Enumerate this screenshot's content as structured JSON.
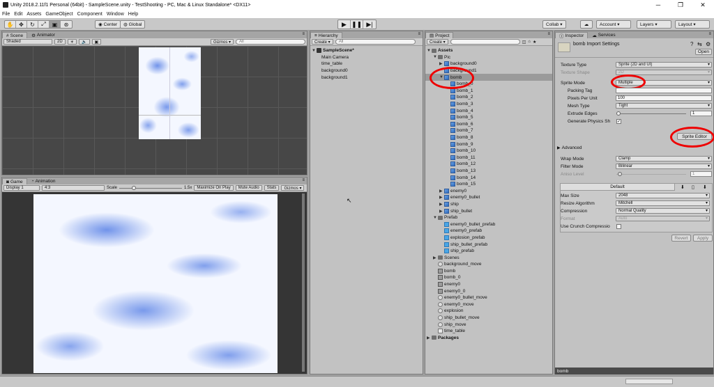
{
  "window": {
    "title": "Unity 2018.2.11f1 Personal (64bit) - SampleScene.unity - TestShooting - PC, Mac & Linux Standalone* <DX11>"
  },
  "menu": [
    "File",
    "Edit",
    "Assets",
    "GameObject",
    "Component",
    "Window",
    "Help"
  ],
  "toolbar": {
    "center": "Center",
    "global": "Global",
    "collab": "Collab ▾",
    "account": "Account ▾",
    "layers": "Layers ▾",
    "layout": "Layout ▾"
  },
  "scene": {
    "tab": "Scene",
    "tab2": "Animator",
    "shading": "Shaded",
    "mode2d": "2D",
    "gizmos": "Gizmos ▾",
    "search": "All"
  },
  "game": {
    "tab": "Game",
    "tab2": "Animation",
    "display": "Display 1",
    "aspect": "4:3",
    "scale_label": "Scale",
    "scale_value": "1.5x",
    "maximize": "Maximize On Play",
    "mute": "Mute Audio",
    "stats": "Stats",
    "gizmos": "Gizmos ▾"
  },
  "hierarchy": {
    "tab": "Hierarchy",
    "create": "Create ▾",
    "search": "All",
    "scene_name": "SampleScene*",
    "items": [
      "Main Camera",
      "time_table",
      "background0",
      "background1"
    ]
  },
  "project": {
    "tab": "Project",
    "create": "Create ▾",
    "items": [
      {
        "label": "Assets",
        "icon": "folder",
        "indent": 0,
        "arrow": "▼",
        "bold": true
      },
      {
        "label": "Pic",
        "icon": "folder",
        "indent": 1,
        "arrow": "▼"
      },
      {
        "label": "background0",
        "icon": "sprite",
        "indent": 2,
        "arrow": "▶"
      },
      {
        "label": "background1",
        "icon": "sprite",
        "indent": 2,
        "arrow": ""
      },
      {
        "label": "bomb",
        "icon": "sprite",
        "indent": 2,
        "arrow": "▼",
        "selected": true
      },
      {
        "label": "bomb_0",
        "icon": "sprite",
        "indent": 3,
        "arrow": ""
      },
      {
        "label": "bomb_1",
        "icon": "sprite",
        "indent": 3,
        "arrow": ""
      },
      {
        "label": "bomb_2",
        "icon": "sprite",
        "indent": 3,
        "arrow": ""
      },
      {
        "label": "bomb_3",
        "icon": "sprite",
        "indent": 3,
        "arrow": ""
      },
      {
        "label": "bomb_4",
        "icon": "sprite",
        "indent": 3,
        "arrow": ""
      },
      {
        "label": "bomb_5",
        "icon": "sprite",
        "indent": 3,
        "arrow": ""
      },
      {
        "label": "bomb_6",
        "icon": "sprite",
        "indent": 3,
        "arrow": ""
      },
      {
        "label": "bomb_7",
        "icon": "sprite",
        "indent": 3,
        "arrow": ""
      },
      {
        "label": "bomb_8",
        "icon": "sprite",
        "indent": 3,
        "arrow": ""
      },
      {
        "label": "bomb_9",
        "icon": "sprite",
        "indent": 3,
        "arrow": ""
      },
      {
        "label": "bomb_10",
        "icon": "sprite",
        "indent": 3,
        "arrow": ""
      },
      {
        "label": "bomb_11",
        "icon": "sprite",
        "indent": 3,
        "arrow": ""
      },
      {
        "label": "bomb_12",
        "icon": "sprite",
        "indent": 3,
        "arrow": ""
      },
      {
        "label": "bomb_13",
        "icon": "sprite",
        "indent": 3,
        "arrow": ""
      },
      {
        "label": "bomb_14",
        "icon": "sprite",
        "indent": 3,
        "arrow": ""
      },
      {
        "label": "bomb_15",
        "icon": "sprite",
        "indent": 3,
        "arrow": ""
      },
      {
        "label": "enemy0",
        "icon": "sprite",
        "indent": 2,
        "arrow": "▶"
      },
      {
        "label": "enemy0_bullet",
        "icon": "sprite",
        "indent": 2,
        "arrow": "▶"
      },
      {
        "label": "ship",
        "icon": "sprite",
        "indent": 2,
        "arrow": "▶"
      },
      {
        "label": "ship_bullet",
        "icon": "sprite",
        "indent": 2,
        "arrow": "▶"
      },
      {
        "label": "Prefab",
        "icon": "folder",
        "indent": 1,
        "arrow": "▼"
      },
      {
        "label": "enemy0_bullet_prefab",
        "icon": "prefab",
        "indent": 2,
        "arrow": ""
      },
      {
        "label": "enemy0_prefab",
        "icon": "prefab",
        "indent": 2,
        "arrow": ""
      },
      {
        "label": "explosion_prefab",
        "icon": "prefab",
        "indent": 2,
        "arrow": ""
      },
      {
        "label": "ship_bullet_prefab",
        "icon": "prefab",
        "indent": 2,
        "arrow": ""
      },
      {
        "label": "ship_prefab",
        "icon": "prefab",
        "indent": 2,
        "arrow": ""
      },
      {
        "label": "Scenes",
        "icon": "folder",
        "indent": 1,
        "arrow": "▶"
      },
      {
        "label": "background_move",
        "icon": "anim",
        "indent": 1,
        "arrow": ""
      },
      {
        "label": "bomb",
        "icon": "ctrl",
        "indent": 1,
        "arrow": ""
      },
      {
        "label": "bomb_0",
        "icon": "ctrl",
        "indent": 1,
        "arrow": ""
      },
      {
        "label": "enemy0",
        "icon": "ctrl",
        "indent": 1,
        "arrow": ""
      },
      {
        "label": "enemy0_0",
        "icon": "ctrl",
        "indent": 1,
        "arrow": ""
      },
      {
        "label": "enemy0_bullet_move",
        "icon": "anim",
        "indent": 1,
        "arrow": ""
      },
      {
        "label": "enemy0_move",
        "icon": "anim",
        "indent": 1,
        "arrow": ""
      },
      {
        "label": "explosion",
        "icon": "anim",
        "indent": 1,
        "arrow": ""
      },
      {
        "label": "ship_bullet_move",
        "icon": "anim",
        "indent": 1,
        "arrow": ""
      },
      {
        "label": "ship_move",
        "icon": "anim",
        "indent": 1,
        "arrow": ""
      },
      {
        "label": "time_table",
        "icon": "script",
        "indent": 1,
        "arrow": ""
      },
      {
        "label": "Packages",
        "icon": "folder",
        "indent": 0,
        "arrow": "▶",
        "bold": true
      }
    ]
  },
  "inspector": {
    "tab": "Inspector",
    "tab2": "Services",
    "title": "bomb Import Settings",
    "open": "Open",
    "texture_type_label": "Texture Type",
    "texture_type": "Sprite (2D and UI)",
    "texture_shape_label": "Texture Shape",
    "texture_shape": "2D",
    "sprite_mode_label": "Sprite Mode",
    "sprite_mode": "Multiple",
    "packing_tag_label": "Packing Tag",
    "ppu_label": "Pixels Per Unit",
    "ppu": "100",
    "mesh_type_label": "Mesh Type",
    "mesh_type": "Tight",
    "extrude_label": "Extrude Edges",
    "extrude": "1",
    "physics_label": "Generate Physics Sh",
    "sprite_editor": "Sprite Editor",
    "advanced": "Advanced",
    "wrap_label": "Wrap Mode",
    "wrap": "Clamp",
    "filter_label": "Filter Mode",
    "filter": "Bilinear",
    "aniso_label": "Aniso Level",
    "aniso": "1",
    "default_tab": "Default",
    "max_size_label": "Max Size",
    "max_size": "2048",
    "resize_label": "Resize Algorithm",
    "resize": "Mitchell",
    "compression_label": "Compression",
    "compression": "Normal Quality",
    "format_label": "Format",
    "format": "Auto",
    "crunch_label": "Use Crunch Compressio",
    "revert": "Revert",
    "apply": "Apply",
    "preview_label": "bomb"
  },
  "colors": {
    "highlight": "#e00000",
    "selection": "#9a9a9a"
  }
}
